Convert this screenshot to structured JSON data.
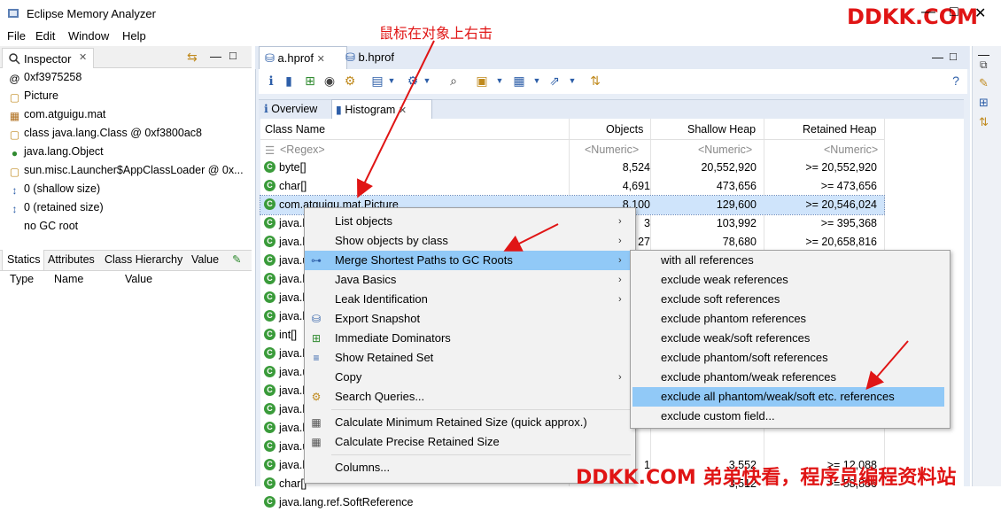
{
  "window": {
    "title": "Eclipse Memory Analyzer",
    "minimize": "—",
    "maximize": "□",
    "close": "✕"
  },
  "menubar": [
    "File",
    "Edit",
    "Window",
    "Help"
  ],
  "watermark_top": "DDKK.COM",
  "annotation": "鼠标在对象上右击",
  "inspector": {
    "tab_label": "Inspector",
    "tab_close": "✕",
    "rows": [
      {
        "icon": "@",
        "text": "0xf3975258"
      },
      {
        "icon": "class",
        "text": "Picture"
      },
      {
        "icon": "pkg",
        "text": "com.atguigu.mat"
      },
      {
        "icon": "class",
        "text": "class java.lang.Class @ 0xf3800ac8"
      },
      {
        "icon": "obj",
        "text": "java.lang.Object"
      },
      {
        "icon": "class",
        "text": "sun.misc.Launcher$AppClassLoader @ 0x..."
      },
      {
        "icon": "size",
        "text": "0 (shallow size)"
      },
      {
        "icon": "size",
        "text": "0 (retained size)"
      },
      {
        "icon": "",
        "text": "no GC root"
      }
    ],
    "bottom_tabs": [
      "Statics",
      "Attributes",
      "Class Hierarchy",
      "Value"
    ],
    "columns": [
      "Type",
      "Name",
      "Value"
    ]
  },
  "editor": {
    "tabs": [
      {
        "label": "a.hprof",
        "close": "✕",
        "active": true
      },
      {
        "label": "b.hprof",
        "close": "",
        "active": false
      }
    ],
    "subtabs": [
      {
        "label": "Overview",
        "active": false
      },
      {
        "label": "Histogram",
        "active": true,
        "close": "✕"
      }
    ]
  },
  "histogram": {
    "headers": [
      "Class Name",
      "Objects",
      "Shallow Heap",
      "Retained Heap"
    ],
    "filter": [
      "<Regex>",
      "<Numeric>",
      "<Numeric>",
      "<Numeric>"
    ],
    "rows": [
      {
        "name": "byte[]",
        "objects": "8,524",
        "shallow": "20,552,920",
        "retained": ">= 20,552,920"
      },
      {
        "name": "char[]",
        "objects": "4,691",
        "shallow": "473,656",
        "retained": ">= 473,656"
      },
      {
        "name": "com.atguigu.mat.Picture",
        "objects": "8,100",
        "shallow": "129,600",
        "retained": ">= 20,546,024"
      },
      {
        "name": "java.l",
        "objects": "3",
        "shallow": "103,992",
        "retained": ">= 395,368"
      },
      {
        "name": "java.l",
        "objects": "27",
        "shallow": "78,680",
        "retained": ">= 20,658,816"
      },
      {
        "name": "java.u",
        "objects": "",
        "shallow": "",
        "retained": ""
      },
      {
        "name": "java.l",
        "objects": "",
        "shallow": "",
        "retained": ""
      },
      {
        "name": "java.l",
        "objects": "",
        "shallow": "",
        "retained": ""
      },
      {
        "name": "java.l",
        "objects": "",
        "shallow": "",
        "retained": ""
      },
      {
        "name": "int[]",
        "objects": "",
        "shallow": "",
        "retained": ""
      },
      {
        "name": "java.l",
        "objects": "",
        "shallow": "",
        "retained": ""
      },
      {
        "name": "java.u",
        "objects": "",
        "shallow": "",
        "retained": ""
      },
      {
        "name": "java.l",
        "objects": "",
        "shallow": "",
        "retained": ""
      },
      {
        "name": "java.l",
        "objects": "",
        "shallow": "",
        "retained": ""
      },
      {
        "name": "java.l",
        "objects": "",
        "shallow": "",
        "retained": ""
      },
      {
        "name": "java.u",
        "objects": "",
        "shallow": "",
        "retained": ""
      },
      {
        "name": "java.l",
        "objects": "1",
        "shallow": "3,552",
        "retained": ">= 12,088"
      },
      {
        "name": "char[]",
        "objects": "",
        "shallow": "3,512",
        "retained": ">= 58,856"
      },
      {
        "name": "java.lang.ref.SoftReference",
        "objects": "",
        "shallow": "",
        "retained": ""
      }
    ]
  },
  "context_menu": {
    "items": [
      {
        "label": "List objects",
        "submenu": true,
        "icon": ""
      },
      {
        "label": "Show objects by class",
        "submenu": true,
        "icon": ""
      },
      {
        "label": "Merge Shortest Paths to GC Roots",
        "submenu": true,
        "icon": "paths",
        "highlighted": true
      },
      {
        "label": "Java Basics",
        "submenu": true,
        "icon": ""
      },
      {
        "label": "Leak Identification",
        "submenu": true,
        "icon": ""
      },
      {
        "label": "Export Snapshot",
        "submenu": false,
        "icon": "export"
      },
      {
        "label": "Immediate Dominators",
        "submenu": false,
        "icon": "dominators"
      },
      {
        "label": "Show Retained Set",
        "submenu": false,
        "icon": "retained"
      },
      {
        "label": "Copy",
        "submenu": true,
        "icon": ""
      },
      {
        "label": "Search Queries...",
        "submenu": false,
        "icon": "search"
      },
      {
        "label": "Calculate Minimum Retained Size (quick approx.)",
        "submenu": false,
        "icon": "calc"
      },
      {
        "label": "Calculate Precise Retained Size",
        "submenu": false,
        "icon": "calc"
      },
      {
        "label": "Columns...",
        "submenu": false,
        "icon": ""
      }
    ],
    "submenu_arrow": "›"
  },
  "submenu": {
    "items": [
      {
        "label": "with all references"
      },
      {
        "label": "exclude weak references"
      },
      {
        "label": "exclude soft references"
      },
      {
        "label": "exclude phantom references"
      },
      {
        "label": "exclude weak/soft references"
      },
      {
        "label": "exclude phantom/soft references"
      },
      {
        "label": "exclude phantom/weak references"
      },
      {
        "label": "exclude all phantom/weak/soft etc. references",
        "highlighted": true
      },
      {
        "label": "exclude custom field..."
      }
    ]
  },
  "watermark_bottom": "DDKK.COM 弟弟快看，程序员编程资料站",
  "colors": {
    "highlight": "#91c9f7",
    "accent_red": "#e01515",
    "class_green": "#3a9b3a"
  }
}
